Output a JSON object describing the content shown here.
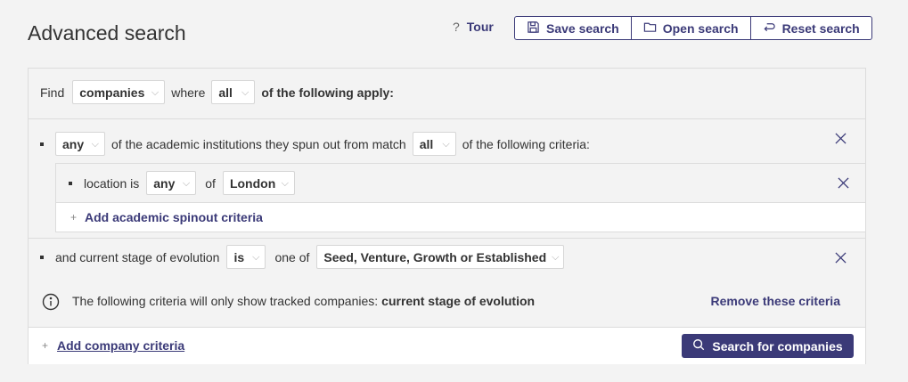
{
  "header": {
    "title": "Advanced search",
    "tour_icon": "?",
    "tour_label": "Tour",
    "save_label": "Save search",
    "open_label": "Open search",
    "reset_label": "Reset search"
  },
  "find_row": {
    "find": "Find",
    "entity": "companies",
    "where": "where",
    "match": "all",
    "suffix": "of the following apply:"
  },
  "spinout": {
    "quantifier": "any",
    "text": "of the academic institutions they spun out from match",
    "match": "all",
    "suffix": "of the following criteria:",
    "location_label": "location is",
    "location_quantifier": "any",
    "of": "of",
    "location_value": "London",
    "add_label": "Add academic spinout criteria",
    "plus": "+"
  },
  "stage": {
    "text": "and current stage of evolution",
    "operator": "is",
    "one_of": "one of",
    "value": "Seed, Venture, Growth or Established"
  },
  "info": {
    "text": "The following criteria will only show tracked companies:",
    "field": "current stage of evolution",
    "remove_label": "Remove these criteria"
  },
  "footer": {
    "plus": "+",
    "add_label": "Add company criteria",
    "search_label": "Search for companies"
  },
  "colors": {
    "accent": "#3b3a78",
    "background": "#f3f3f3",
    "border": "#dcdcdc"
  }
}
